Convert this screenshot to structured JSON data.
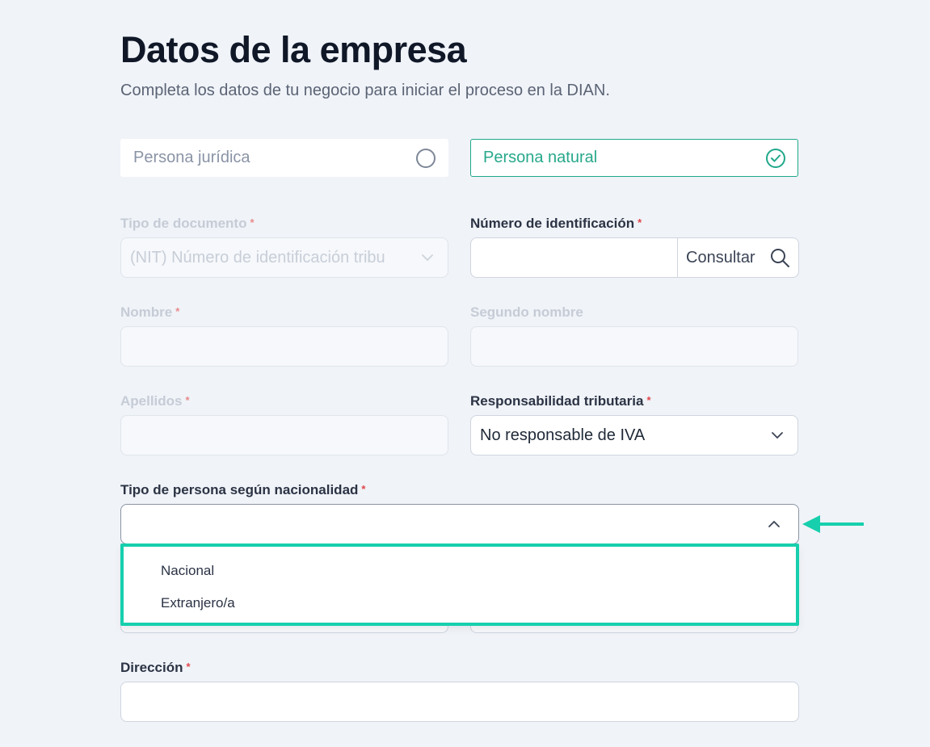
{
  "header": {
    "title": "Datos de la empresa",
    "subtitle": "Completa los datos de tu negocio para iniciar el proceso en la DIAN."
  },
  "person_type": {
    "options": [
      {
        "label": "Persona jurídica",
        "selected": false
      },
      {
        "label": "Persona natural",
        "selected": true
      }
    ]
  },
  "fields": {
    "tipo_documento": {
      "label": "Tipo de documento",
      "required_mark": "*",
      "value": "(NIT) Número de identificación tribu",
      "disabled": true
    },
    "numero_identificacion": {
      "label": "Número de identificación",
      "required_mark": "*",
      "value": "",
      "button_label": "Consultar"
    },
    "nombre": {
      "label": "Nombre",
      "required_mark": "*",
      "value": "",
      "disabled": true
    },
    "segundo_nombre": {
      "label": "Segundo nombre",
      "value": "",
      "disabled": true
    },
    "apellidos": {
      "label": "Apellidos",
      "required_mark": "*",
      "value": "",
      "disabled": true
    },
    "responsabilidad": {
      "label": "Responsabilidad tributaria",
      "required_mark": "*",
      "value": "No responsable de IVA"
    },
    "nacionalidad": {
      "label": "Tipo de persona según nacionalidad",
      "required_mark": "*",
      "value": "",
      "open": true,
      "options": [
        "Nacional",
        "Extranjero/a"
      ]
    },
    "direccion": {
      "label": "Dirección",
      "required_mark": "*",
      "value": ""
    }
  },
  "colors": {
    "accent": "#1fa88a",
    "highlight": "#17cfad",
    "required": "#e0474c",
    "background": "#f0f3f8"
  },
  "icons": {
    "unselected_radio": "radio-empty-icon",
    "selected_radio": "check-circle-icon",
    "search": "search-icon",
    "chevron_down": "chevron-down-icon",
    "chevron_up": "chevron-up-icon",
    "annotation": "arrow-left-icon"
  }
}
